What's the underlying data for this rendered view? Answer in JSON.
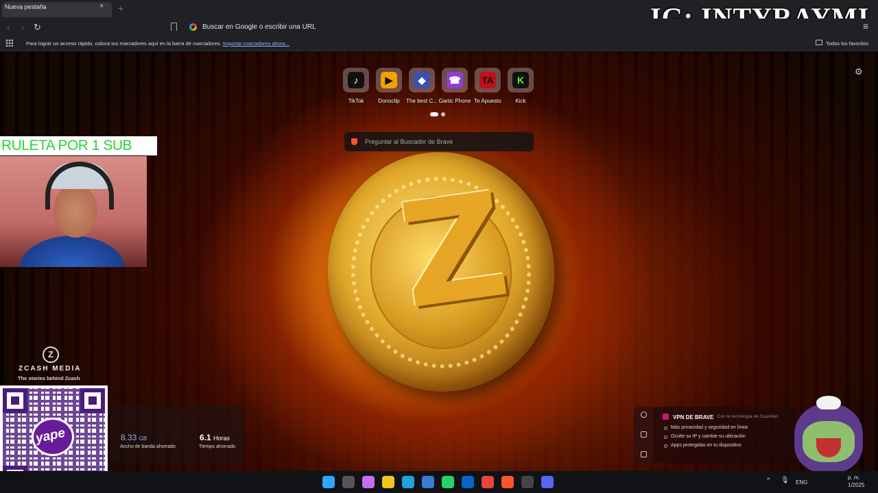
{
  "browser": {
    "tab_title": "Nueva pestaña",
    "tab_close": "×",
    "new_tab": "+",
    "omnibox_placeholder": "Buscar en Google o escribir una URL",
    "bookmarks_prompt": "Para lograr un acceso rápido, coloca tus marcadores aquí en la barra de marcadores.",
    "import_bookmarks": "Importar marcadores ahora...",
    "all_favorites": "Todos los favoritos"
  },
  "overlay": {
    "ig_handle": "IG: INTYRAYMI",
    "ruleta": "RULETA POR 1 SUB",
    "zcash_title": "ZCASH MEDIA",
    "zcash_subtitle": "The stories behind Zcash",
    "zcash_logo": "Z",
    "yape": "yape"
  },
  "shortcuts": [
    {
      "label": "TikTok",
      "icon": "tiktok-icon",
      "glyph": "♪",
      "bg": "#111111",
      "fg": "#ffffff"
    },
    {
      "label": "Donoclip",
      "icon": "donoclip-icon",
      "glyph": "▶",
      "bg": "#f5a000",
      "fg": "#111111"
    },
    {
      "label": "The best C...",
      "icon": "dice-icon",
      "glyph": "◆",
      "bg": "#3d4fb0",
      "fg": "#ffffff"
    },
    {
      "label": "Gartic Phone",
      "icon": "gartic-icon",
      "glyph": "☎",
      "bg": "#8d3fd1",
      "fg": "#ffffff"
    },
    {
      "label": "Te Apuesto",
      "icon": "teapuesto-icon",
      "glyph": "TA",
      "bg": "#c0101a",
      "fg": "#111111"
    },
    {
      "label": "Kick",
      "icon": "kick-icon",
      "glyph": "K",
      "bg": "#111111",
      "fg": "#53fc18"
    }
  ],
  "search": {
    "placeholder": "Preguntar al Buscador de Brave"
  },
  "stats": {
    "bandwidth_value": "8.33",
    "bandwidth_unit": "GB",
    "bandwidth_label": "Ancho de banda ahorrado",
    "time_value": "6.1",
    "time_unit": "Horas",
    "time_label": "Tiempo ahorrado"
  },
  "vpn": {
    "title": "VPN DE BRAVE",
    "tech": "Con la tecnología de Guardian",
    "items": [
      "Más privacidad y seguridad en línea",
      "Oculte su IP y cambie su ubicación",
      "Apps protegidas en tu dispositivo"
    ]
  },
  "taskbar": {
    "language": "ENG",
    "clock_time": "p. m.",
    "clock_date": "1/2025",
    "apps": [
      {
        "name": "start-icon",
        "color": "#2fa6ff"
      },
      {
        "name": "taskview-icon",
        "color": "#555555"
      },
      {
        "name": "copilot-icon",
        "color": "#c46ef0"
      },
      {
        "name": "file-explorer-icon",
        "color": "#f5c518"
      },
      {
        "name": "edge-icon",
        "color": "#1fa3d9"
      },
      {
        "name": "store-icon",
        "color": "#3a7bd5"
      },
      {
        "name": "whatsapp-icon",
        "color": "#25d366"
      },
      {
        "name": "outlook-icon",
        "color": "#0a64c7"
      },
      {
        "name": "chrome-icon",
        "color": "#e8453c"
      },
      {
        "name": "brave-icon",
        "color": "#fb542b"
      },
      {
        "name": "obs-icon",
        "color": "#444444"
      },
      {
        "name": "discord-icon",
        "color": "#5865f2"
      }
    ]
  }
}
